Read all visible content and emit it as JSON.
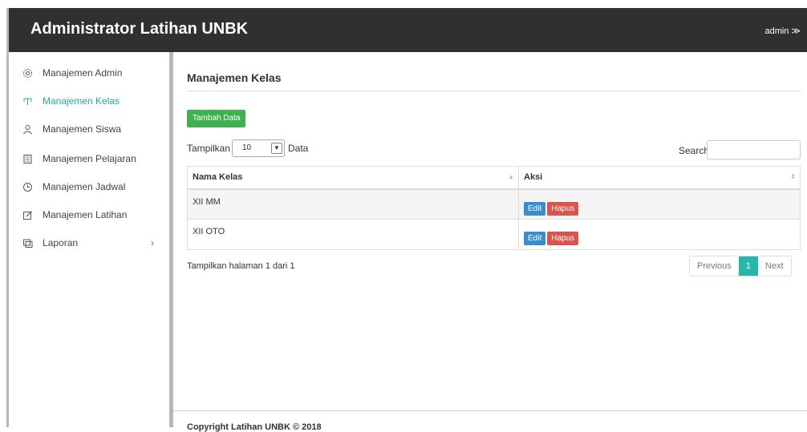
{
  "app": {
    "title": "Administrator Latihan UNBK",
    "user": "admin ≫"
  },
  "sidebar": {
    "items": [
      {
        "label": "Manajemen Admin",
        "icon": "gear-icon"
      },
      {
        "label": "Manajemen Kelas",
        "icon": "class-icon"
      },
      {
        "label": "Manajemen Siswa",
        "icon": "user-icon"
      },
      {
        "label": "Manajemen Pelajaran",
        "icon": "book-icon"
      },
      {
        "label": "Manajemen Jadwal",
        "icon": "clock-icon"
      },
      {
        "label": "Manajemen Latihan",
        "icon": "edit-icon"
      },
      {
        "label": "Laporan",
        "icon": "monitor-icon"
      }
    ]
  },
  "main": {
    "title": "Manajemen Kelas",
    "add_button": "Tambah Data",
    "length_label": "Tampilkan",
    "length_value": "10",
    "length_suffix": "Data",
    "search_label": "Search:",
    "table": {
      "headers": [
        "Nama Kelas",
        "Aksi"
      ],
      "rows": [
        {
          "nama": "XII MM",
          "edit": "Edit",
          "hapus": "Hapus"
        },
        {
          "nama": "XII OTO",
          "edit": "Edit",
          "hapus": "Hapus"
        }
      ]
    },
    "info": "Tampilkan halaman 1 dari 1",
    "pager": {
      "previous": "Previous",
      "current": "1",
      "next": "Next"
    }
  },
  "footer": {
    "text": "Copyright Latihan UNBK © 2018"
  }
}
